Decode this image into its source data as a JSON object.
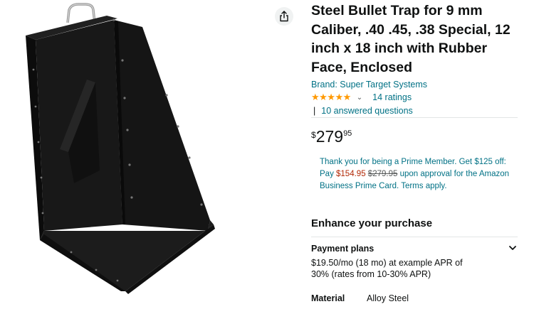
{
  "product": {
    "title": "Steel Bullet Trap for 9 mm Caliber, .40 .45, .38 Special, 12 inch x 18 inch with Rubber Face, Enclosed",
    "brand": "Brand: Super Target Systems",
    "stars_glyphs": "★★★★★",
    "ratings": "14 ratings",
    "qa_separator": "|",
    "questions": "10 answered questions"
  },
  "price": {
    "symbol": "$",
    "whole": "279",
    "fraction": "95"
  },
  "prime_offer": {
    "line1": "Thank you for being a Prime Member. Get $125 off: Pay ",
    "sale_price": "$154.95",
    "list_price": "$279.95",
    "line2": " upon approval for the Amazon Business Prime Card. Terms apply."
  },
  "enhance": {
    "heading": "Enhance your purchase"
  },
  "payment_plans": {
    "title": "Payment plans",
    "description": "$19.50/mo (18 mo) at example APR of 30% (rates from 10-30% APR)"
  },
  "specs": [
    {
      "key": "Material",
      "value": "Alloy Steel"
    }
  ],
  "icons": {
    "share": "share-icon",
    "chevron": "chevron-down-icon",
    "rating_dropdown": "chevron-down-small-icon"
  },
  "colors": {
    "link": "#007185",
    "sale": "#b12704",
    "star": "#ff9900",
    "text": "#0f1111",
    "product_body": "#141414"
  }
}
